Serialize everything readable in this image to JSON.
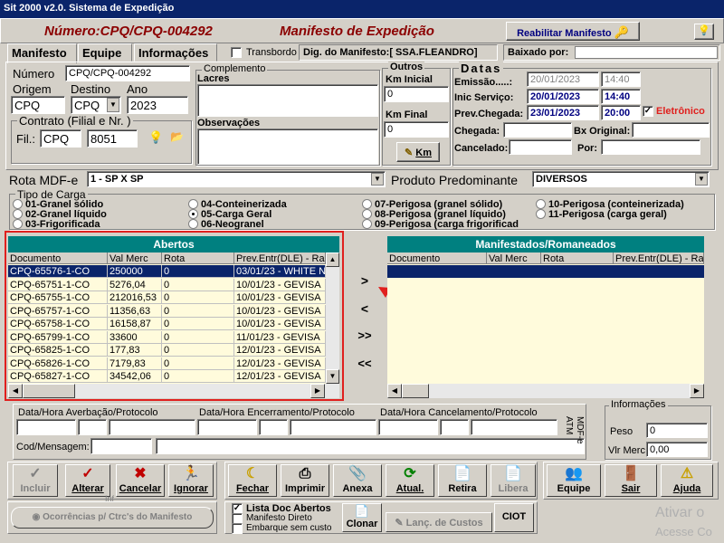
{
  "window": {
    "title": "Sit 2000 v2.0. Sistema de Expedição"
  },
  "header": {
    "numero": "Número:CPQ/CPQ-004292",
    "manifesto_title": "Manifesto de Expedição",
    "reabilitar_label": "Reabilitar Manifesto",
    "help_icon": "lightbulb-icon"
  },
  "tabs": [
    {
      "label": "Manifesto"
    },
    {
      "label": "Equipe"
    },
    {
      "label": "Informações"
    }
  ],
  "transbordo_label": "Transbordo",
  "dig_manifesto": "Dig. do Manifesto:[ SSA.FLEANDRO]",
  "baixado_label": "Baixado por:",
  "left_form": {
    "numero_label": "Número",
    "numero_value": "CPQ/CPQ-004292",
    "origem_label": "Origem",
    "destino_label": "Destino",
    "ano_label": "Ano",
    "origem_value": "CPQ",
    "destino_value": "CPQ",
    "ano_value": "2023",
    "contrato_label": "Contrato (Filial e Nr. )",
    "fil_label": "Fil.:",
    "fil_value": "CPQ",
    "fil_nr": "8051"
  },
  "complemento": {
    "title": "Complemento",
    "lacres_label": "Lacres",
    "observacoes_label": "Observações"
  },
  "outros": {
    "title": "Outros",
    "km_inicial_label": "Km Inicial",
    "km_inicial_value": "0",
    "km_final_label": "Km Final",
    "km_final_value": "0",
    "km_button": "Km"
  },
  "datas": {
    "title": "Datas",
    "emissao_label": "Emissão.....:",
    "emissao_date": "20/01/2023",
    "emissao_time": "14:40",
    "inic_label": "Inic Serviço:",
    "inic_date": "20/01/2023",
    "inic_time": "14:40",
    "prev_label": "Prev.Chegada:",
    "prev_date": "23/01/2023",
    "prev_time": "20:00",
    "eletronico_label": "Eletrônico",
    "chegada_label": "Chegada:",
    "bx_original_label": "Bx Original:",
    "cancelado_label": "Cancelado:",
    "por_label": "Por:"
  },
  "rota": {
    "label": "Rota MDF-e",
    "value": "1 - SP X SP",
    "produto_label": "Produto Predominante",
    "produto_value": "DIVERSOS"
  },
  "tipo_carga": {
    "title": "Tipo de Carga",
    "options": [
      {
        "label": "01-Granel sólido",
        "checked": false
      },
      {
        "label": "02-Granel líquido",
        "checked": false
      },
      {
        "label": "03-Frigorificada",
        "checked": false
      },
      {
        "label": "04-Conteinerizada",
        "checked": false
      },
      {
        "label": "05-Carga Geral",
        "checked": true
      },
      {
        "label": "06-Neogranel",
        "checked": false
      },
      {
        "label": "07-Perigosa (granel sólido)",
        "checked": false
      },
      {
        "label": "08-Perigosa (granel líquido)",
        "checked": false
      },
      {
        "label": "09-Perigosa (carga frigorificad",
        "checked": false
      },
      {
        "label": "10-Perigosa (conteinerizada)",
        "checked": false
      },
      {
        "label": "11-Perigosa (carga geral)",
        "checked": false
      }
    ]
  },
  "abertos": {
    "title": "Abertos",
    "columns": [
      "Documento",
      "Val Merc",
      "Rota",
      "Prev.Entr(DLE) - Raz"
    ],
    "rows": [
      [
        "CPQ-65576-1-CO",
        "250000",
        "0",
        "03/01/23 - WHITE N"
      ],
      [
        "CPQ-65751-1-CO",
        "5276,04",
        "0",
        "10/01/23 - GEVISA"
      ],
      [
        "CPQ-65755-1-CO",
        "212016,53",
        "0",
        "10/01/23 - GEVISA"
      ],
      [
        "CPQ-65757-1-CO",
        "11356,63",
        "0",
        "10/01/23 - GEVISA"
      ],
      [
        "CPQ-65758-1-CO",
        "16158,87",
        "0",
        "10/01/23 - GEVISA"
      ],
      [
        "CPQ-65799-1-CO",
        "33600",
        "0",
        "11/01/23 - GEVISA"
      ],
      [
        "CPQ-65825-1-CO",
        "177,83",
        "0",
        "12/01/23 - GEVISA"
      ],
      [
        "CPQ-65826-1-CO",
        "7179,83",
        "0",
        "12/01/23 - GEVISA"
      ],
      [
        "CPQ-65827-1-CO",
        "34542,06",
        "0",
        "12/01/23 - GEVISA"
      ]
    ]
  },
  "transfer": {
    "move_one": ">",
    "back_one": "<",
    "move_all": ">>",
    "back_all": "<<"
  },
  "manifestados": {
    "title": "Manifestados/Romaneados",
    "columns": [
      "Documento",
      "Val Merc",
      "Rota",
      "Prev.Entr(DLE) - Ra"
    ]
  },
  "protocolo": {
    "averbacao_label": "Data/Hora Averbação/Protocolo",
    "encerramento_label": "Data/Hora Encerramento/Protocolo",
    "cancelamento_label": "Data/Hora Cancelamento/Protocolo",
    "cod_label": "Cod/Mensagem:",
    "mdfe_label": "MDF-e",
    "atm_label": "ATM"
  },
  "informacoes": {
    "title": "Informações",
    "peso_label": "Peso",
    "peso_value": "0",
    "vlr_label": "Vlr Merc.",
    "vlr_value": "0,00"
  },
  "toolbar": {
    "incluir": "Incluir",
    "alterar": "Alterar",
    "cancelar": "Cancelar",
    "ignorar": "Ignorar",
    "fechar": "Fechar",
    "imprimir": "Imprimir",
    "anexa": "Anexa",
    "atual": "Atual.",
    "retira": "Retira",
    "libera": "Libera",
    "equipe": "Equipe",
    "sair": "Sair",
    "ajuda": "Ajuda",
    "ocorrencias": "Ocorrências p/ Ctrc's do Manifesto",
    "lista_doc": "Lista Doc Abertos",
    "manifesto_direto": "Manifesto Direto",
    "embarque": "Embarque sem custo",
    "clonar": "Clonar",
    "lanc_custos": "Lanç. de Custos",
    "ciot": "CIOT",
    "extra_label": "Inf"
  },
  "watermark": {
    "line1": "Ativar o",
    "line2": "Acesse Co"
  },
  "colors": {
    "title_bg": "#0a246a",
    "grid_header": "#008080",
    "highlight": "#e0201e",
    "selected_row": "#0a246a",
    "grid_bg": "#fffbdc"
  }
}
